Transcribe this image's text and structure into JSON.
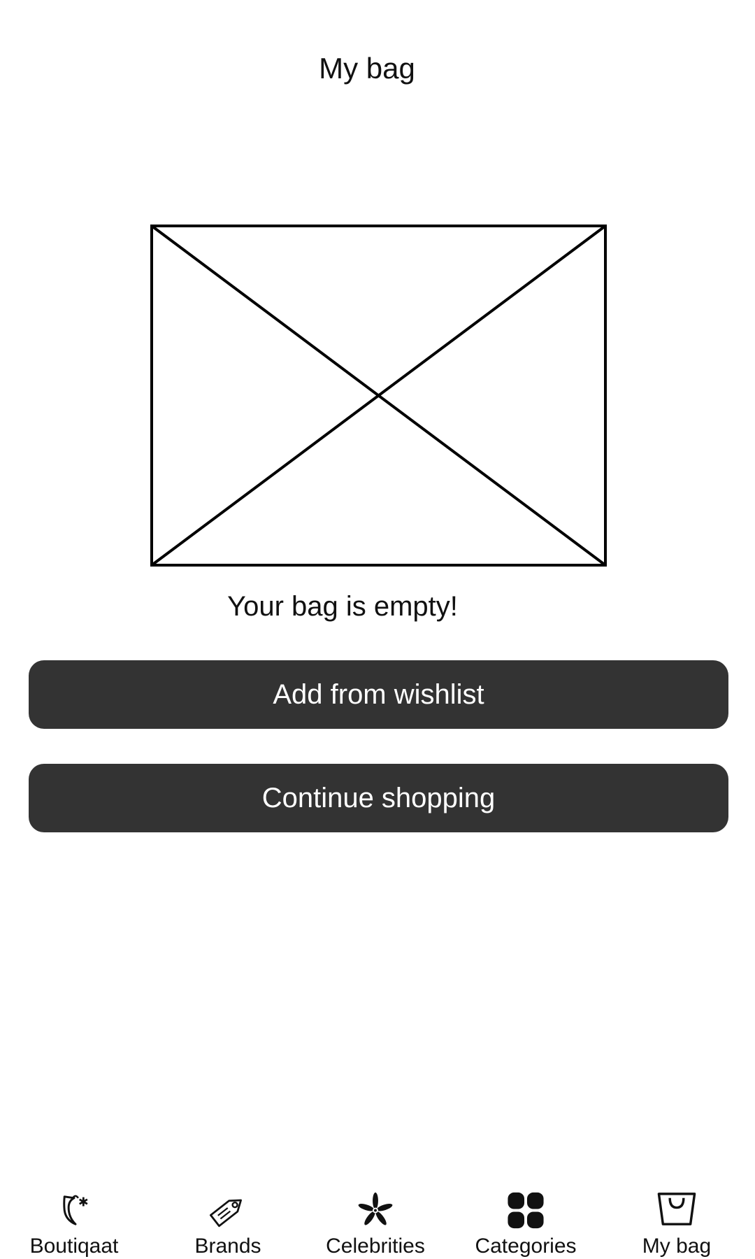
{
  "header": {
    "title": "My bag"
  },
  "empty_state": {
    "image": "image-placeholder",
    "message": "Your bag is empty!"
  },
  "actions": {
    "add_from_wishlist": "Add from wishlist",
    "continue_shopping": "Continue shopping"
  },
  "tabbar": {
    "items": [
      {
        "label": "Boutiqaat",
        "icon": "boutiqaat-logo-icon"
      },
      {
        "label": "Brands",
        "icon": "tag-icon"
      },
      {
        "label": "Celebrities",
        "icon": "flower-icon"
      },
      {
        "label": "Categories",
        "icon": "grid-icon"
      },
      {
        "label": "My bag",
        "icon": "shopping-bag-icon",
        "active": true
      }
    ]
  },
  "colors": {
    "button_bg": "#333333",
    "button_text": "#ffffff",
    "text": "#111111"
  }
}
